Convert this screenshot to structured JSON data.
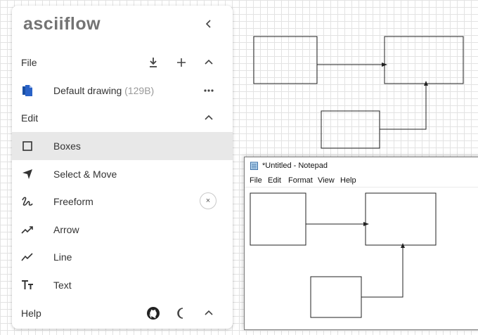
{
  "app": {
    "logo_text": "asciiflow",
    "collapse_icon": "chevron-left-icon"
  },
  "file_section": {
    "label": "File",
    "actions": [
      "download-icon",
      "add-icon",
      "chevron-up-icon"
    ],
    "drawing": {
      "name": "Default drawing",
      "size": "(129B)",
      "icon": "file-copy-icon",
      "menu_icon": "more-horizontal-icon"
    }
  },
  "edit_section": {
    "label": "Edit",
    "toggle_icon": "chevron-up-icon",
    "tools": [
      {
        "label": "Boxes",
        "icon": "square-outline-icon",
        "selected": true
      },
      {
        "label": "Select & Move",
        "icon": "navigation-arrow-icon",
        "selected": false
      },
      {
        "label": "Freeform",
        "icon": "gesture-icon",
        "selected": false,
        "shortcut": "×"
      },
      {
        "label": "Arrow",
        "icon": "trending-up-icon",
        "selected": false
      },
      {
        "label": "Line",
        "icon": "show-chart-icon",
        "selected": false
      },
      {
        "label": "Text",
        "icon": "text-fields-icon",
        "selected": false
      }
    ]
  },
  "help_section": {
    "label": "Help",
    "actions": [
      "github-icon",
      "dark-mode-moon-icon",
      "chevron-up-icon"
    ]
  },
  "notepad": {
    "title": "*Untitled - Notepad",
    "menu": [
      "File",
      "Edit",
      "Format",
      "View",
      "Help"
    ]
  },
  "colors": {
    "accent": "#e8781a",
    "selected_row": "#e8e8e8",
    "grid": "#e3e3e3"
  }
}
